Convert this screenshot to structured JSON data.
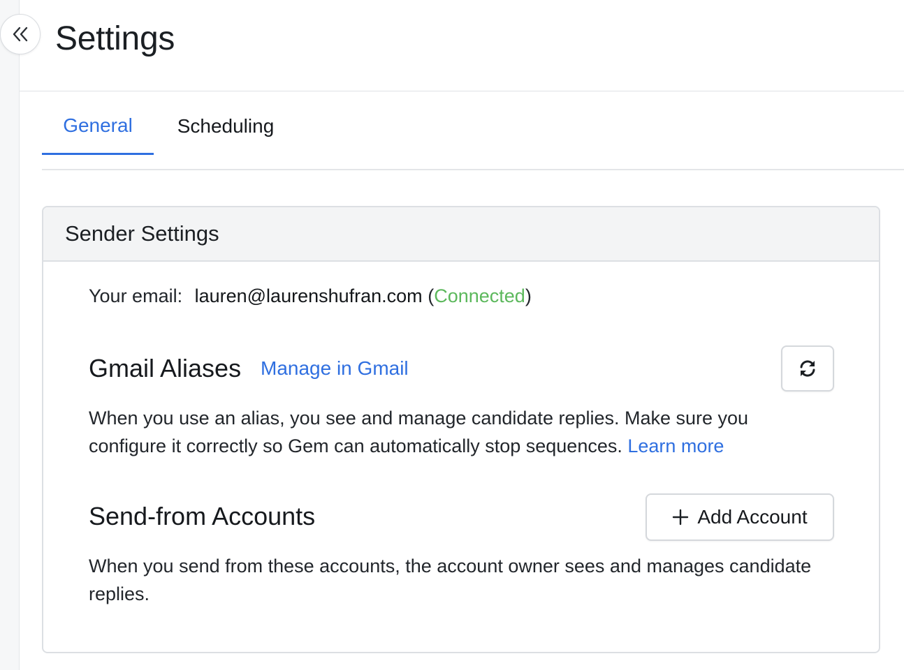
{
  "header": {
    "title": "Settings",
    "collapse_icon": "double-chevron-left-icon"
  },
  "tabs": [
    {
      "label": "General",
      "active": true
    },
    {
      "label": "Scheduling",
      "active": false
    }
  ],
  "sender_settings": {
    "title": "Sender Settings",
    "email_label": "Your email:",
    "email_value": "lauren@laurenshufran.com",
    "status_open": "(",
    "status": "Connected",
    "status_close": ")",
    "gmail_aliases": {
      "title": "Gmail Aliases",
      "manage_link": "Manage in Gmail",
      "refresh_icon": "refresh-icon",
      "description": "When you use an alias, you see and manage candidate replies. Make sure you configure it correctly so Gem can automatically stop sequences.",
      "learn_more": "Learn more"
    },
    "send_from": {
      "title": "Send-from Accounts",
      "add_button": "Add Account",
      "add_icon": "plus-icon",
      "description": "When you send from these accounts, the account owner sees and manages candidate replies."
    }
  },
  "colors": {
    "accent": "#2f6fe0",
    "connected": "#5cb85c",
    "card_header_bg": "#f3f4f5"
  }
}
